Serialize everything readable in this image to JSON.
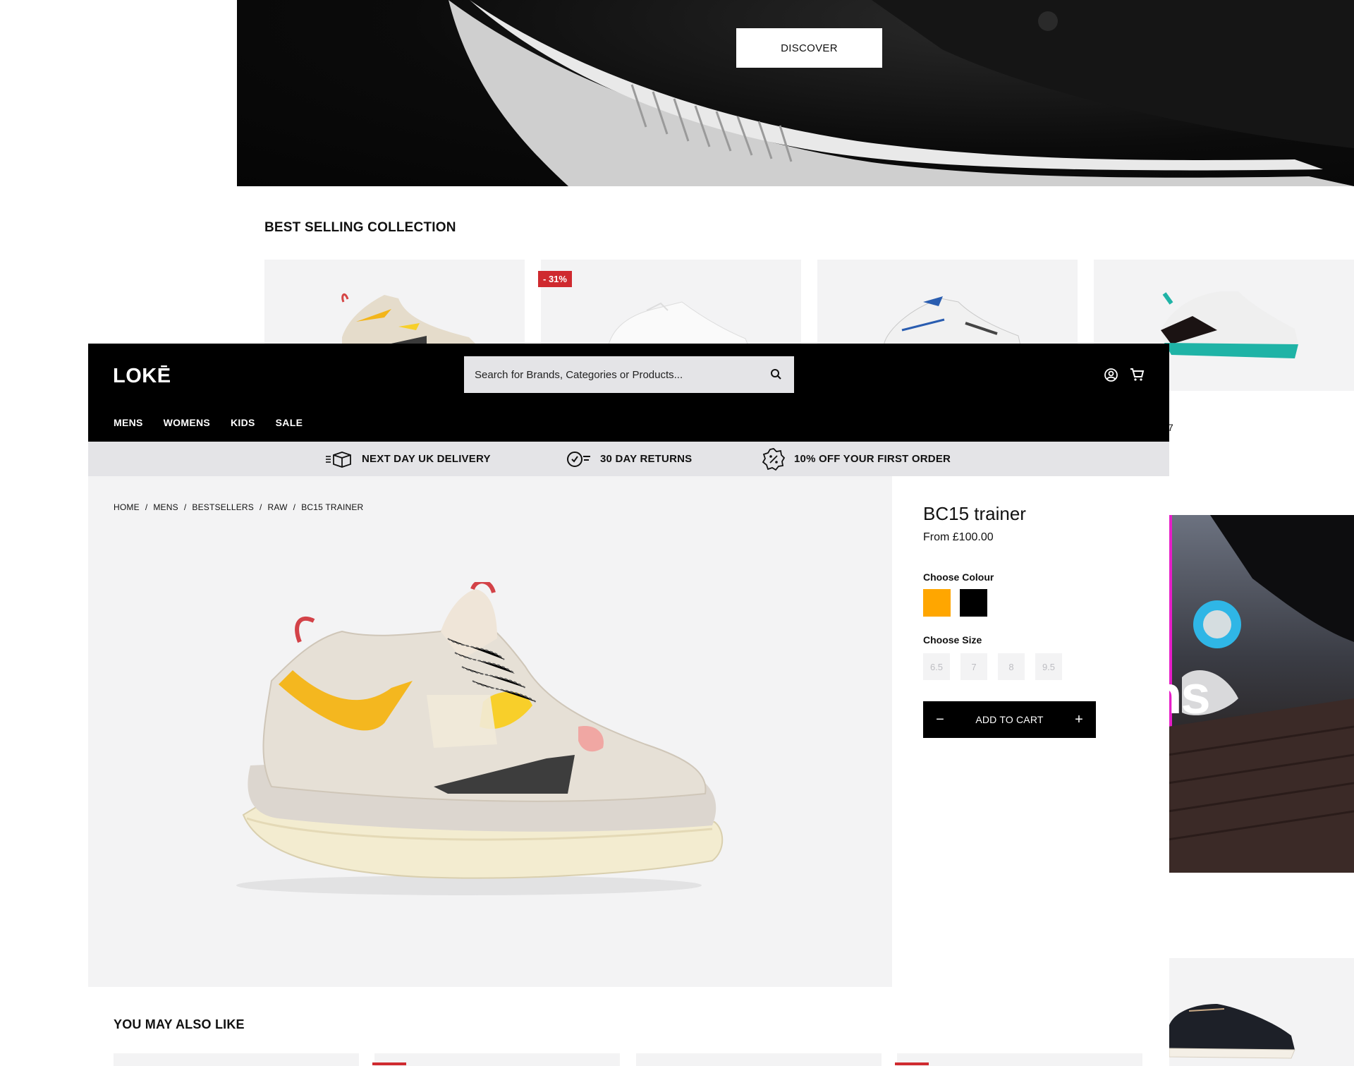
{
  "background_page": {
    "hero_button": "DISCOVER",
    "section_title": "BEST SELLING COLLECTION",
    "discount_badge": "- 31%",
    "fragment_text": "7",
    "promo_text_fragment": "ns"
  },
  "header": {
    "logo": "LOKĒ",
    "search": {
      "placeholder": "Search for Brands, Categories or Products..."
    },
    "nav": [
      "MENS",
      "WOMENS",
      "KIDS",
      "SALE"
    ]
  },
  "usp_bar": [
    {
      "icon": "delivery-box-icon",
      "label": "NEXT DAY UK DELIVERY"
    },
    {
      "icon": "returns-clock-icon",
      "label": "30 DAY RETURNS"
    },
    {
      "icon": "discount-badge-icon",
      "label": "10% OFF YOUR FIRST ORDER"
    }
  ],
  "breadcrumb": [
    "HOME",
    "MENS",
    "BESTSELLERS",
    "RAW",
    "BC15 TRAINER"
  ],
  "breadcrumb_separator": "/",
  "product": {
    "title": "BC15 trainer",
    "price": "From  £100.00",
    "colour_label": "Choose Colour",
    "colours": [
      {
        "name": "orange",
        "hex": "#ffa600",
        "selected": true
      },
      {
        "name": "black",
        "hex": "#000000",
        "selected": false
      }
    ],
    "size_label": "Choose Size",
    "sizes": [
      "6.5",
      "7",
      "8",
      "9.5"
    ],
    "add_to_cart": "ADD TO CART",
    "qty_minus": "−",
    "qty_plus": "+"
  },
  "related": {
    "title": "YOU MAY ALSO LIKE"
  },
  "colors": {
    "badge_red": "#cf2a2f",
    "panel_grey": "#f3f3f4",
    "bar_grey": "#e4e4e7"
  }
}
